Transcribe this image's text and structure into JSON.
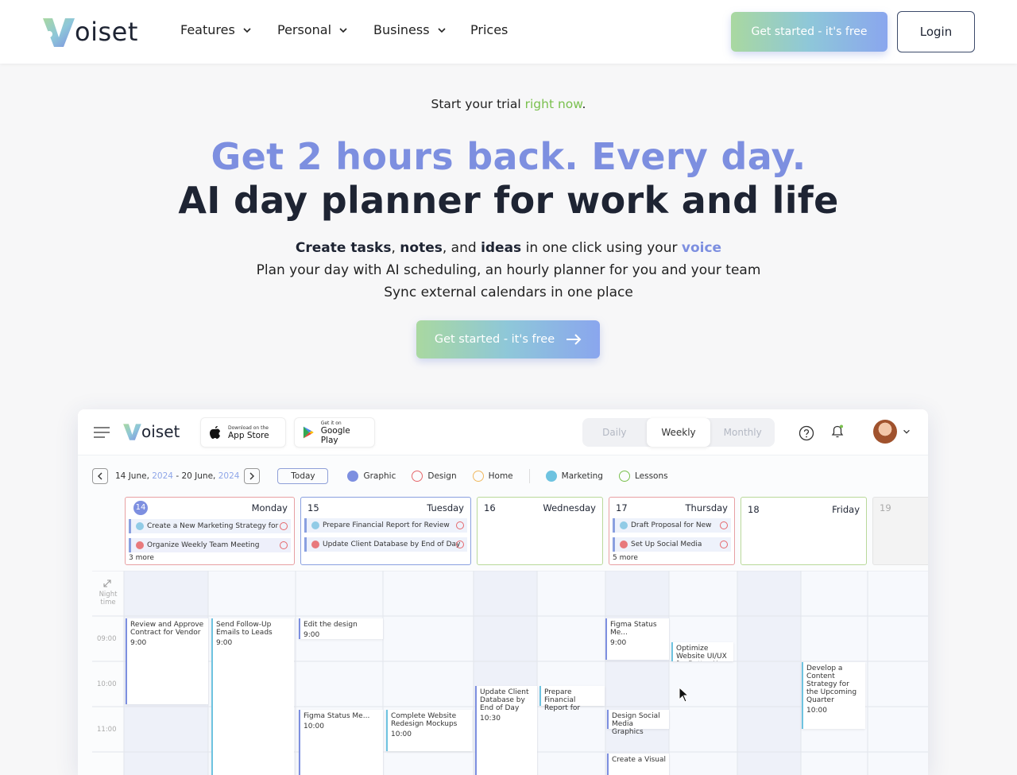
{
  "brand": {
    "name": "oiset"
  },
  "nav": {
    "items": [
      {
        "label": "Features"
      },
      {
        "label": "Personal"
      },
      {
        "label": "Business"
      },
      {
        "label": "Prices"
      }
    ],
    "cta": "Get started - it's free",
    "login": "Login"
  },
  "hero": {
    "trial_pre": "Start your",
    "trial_mid": "trial",
    "trial_link": "right now",
    "trial_end": ".",
    "headline_1": "Get 2 hours back. Every day.",
    "headline_2": "AI day planner for work and life",
    "line1": {
      "b1": "Create tasks",
      "s1": ",",
      "b2": "notes",
      "s2": ", and",
      "b3": "ideas",
      "s3": "in one click using your",
      "voice": "voice"
    },
    "line2": "Plan your day with AI scheduling, an hourly planner for you and your team",
    "line3": "Sync external calendars in one place",
    "cta": "Get started - it's free"
  },
  "app": {
    "brand": "oiset",
    "appstore": {
      "small": "Download on the",
      "big": "App Store"
    },
    "googleplay": {
      "small": "Get it on",
      "big": "Google Play"
    },
    "views": [
      "Daily",
      "Weekly",
      "Monthly"
    ],
    "range": {
      "start": "14 June,",
      "start_year": "2024",
      "sep": "-",
      "end": "20 June,",
      "end_year": "2024"
    },
    "today": "Today",
    "filters": [
      {
        "label": "Graphic",
        "color": "#7d8fe0",
        "checked": true
      },
      {
        "label": "Design",
        "color": "#e5676b",
        "checked": false
      },
      {
        "label": "Home",
        "color": "#f0b860",
        "checked": false
      },
      {
        "label": "Marketing",
        "color": "#6ec3e0",
        "checked": true
      },
      {
        "label": "Lessons",
        "color": "#7ac04e",
        "checked": false
      }
    ],
    "days": [
      {
        "num": "14",
        "name": "Monday",
        "color": "#e5676b",
        "tasks": [
          "Create a New Marketing Strategy for",
          "Organize Weekly Team Meeting"
        ],
        "more": "3 more"
      },
      {
        "num": "15",
        "name": "Tuesday",
        "color": "#8aa0e0",
        "tasks": [
          "Prepare Financial Report for Review",
          "Update Client Database by End of Day"
        ],
        "more": ""
      },
      {
        "num": "16",
        "name": "Wednesday",
        "color": "#a6d17e",
        "tasks": [],
        "more": ""
      },
      {
        "num": "17",
        "name": "Thursday",
        "color": "#e5676b",
        "tasks": [
          "Draft Proposal for New",
          "Set Up Social Media"
        ],
        "more": "5 more"
      },
      {
        "num": "18",
        "name": "Friday",
        "color": "#a6d17e",
        "tasks": [],
        "more": ""
      },
      {
        "num": "19",
        "name": "",
        "color": "#ddd",
        "tasks": [],
        "more": ""
      }
    ],
    "night": "Night time",
    "times": [
      "09:00",
      "10:00",
      "11:00"
    ],
    "events": [
      {
        "title": "Review and Approve Contract for Vendor",
        "time": "9:00"
      },
      {
        "title": "Send Follow-Up Emails to Leads",
        "time": "9:00"
      },
      {
        "title": "Edit the design",
        "time": "9:00"
      },
      {
        "title": "Figma Status Me...",
        "time": "10:00"
      },
      {
        "title": "Complete Website Redesign Mockups",
        "time": "10:00"
      },
      {
        "title": "Update Client Database by End of Day",
        "time": "10:30"
      },
      {
        "title": "Prepare Financial Report for",
        "time": ""
      },
      {
        "title": "Figma Status Me...",
        "time": "9:00"
      },
      {
        "title": "Optimize Website UI/UX for Better U...",
        "time": ""
      },
      {
        "title": "Design Social Media Graphics",
        "time": ""
      },
      {
        "title": "Create a Visual",
        "time": ""
      },
      {
        "title": "Develop a Content Strategy for the Upcoming Quarter",
        "time": "10:00"
      }
    ]
  }
}
